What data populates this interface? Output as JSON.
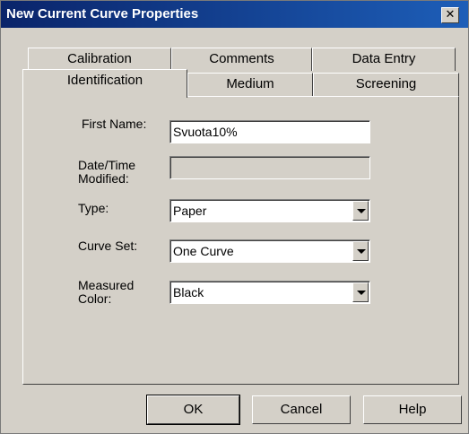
{
  "window": {
    "title": "New Current Curve Properties"
  },
  "tabs_back": [
    {
      "label": "Calibration"
    },
    {
      "label": "Comments"
    },
    {
      "label": "Data Entry"
    }
  ],
  "tabs_front": [
    {
      "label": "Identification",
      "selected": true
    },
    {
      "label": "Medium"
    },
    {
      "label": "Screening"
    }
  ],
  "form": {
    "first_name": {
      "label": "First Name:",
      "value": "Svuota10%"
    },
    "date_modified": {
      "label_line1": "Date/Time",
      "label_line2": "Modified:",
      "value": ""
    },
    "type": {
      "label": "Type:",
      "value": "Paper"
    },
    "curve_set": {
      "label": "Curve Set:",
      "value": "One Curve"
    },
    "measured_color": {
      "label_line1": "Measured",
      "label_line2": "Color:",
      "value": "Black"
    }
  },
  "buttons": {
    "ok": "OK",
    "cancel": "Cancel",
    "help": "Help"
  }
}
